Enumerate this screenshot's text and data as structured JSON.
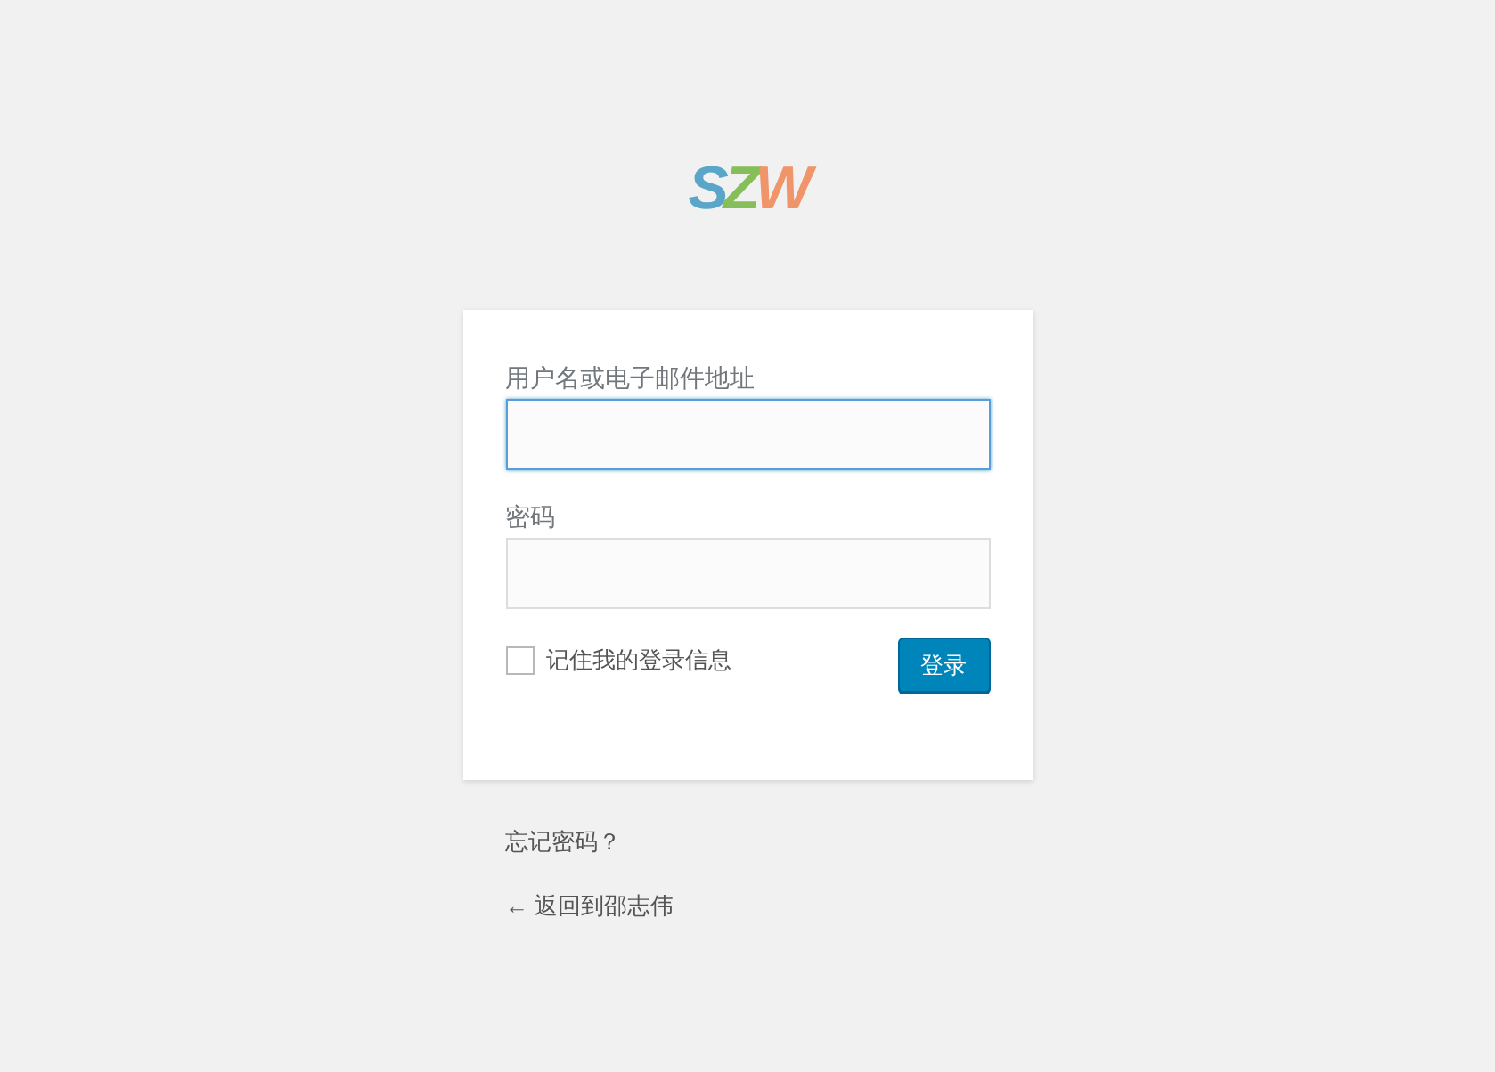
{
  "logo": {
    "letters": [
      {
        "text": "S",
        "color": "#5aa6c8"
      },
      {
        "text": "Z",
        "color": "#86bf5a"
      },
      {
        "text": "W",
        "color": "#f0956a"
      }
    ]
  },
  "form": {
    "fields": [
      {
        "label": "用户名或电子邮件地址",
        "focused": true
      },
      {
        "label": "密码",
        "focused": false
      }
    ],
    "remember": {
      "label": "记住我的登录信息",
      "checked": false
    },
    "submit": "登录"
  },
  "links": [
    {
      "text": "忘记密码？"
    },
    {
      "text": "← 返回到邵志伟"
    }
  ]
}
